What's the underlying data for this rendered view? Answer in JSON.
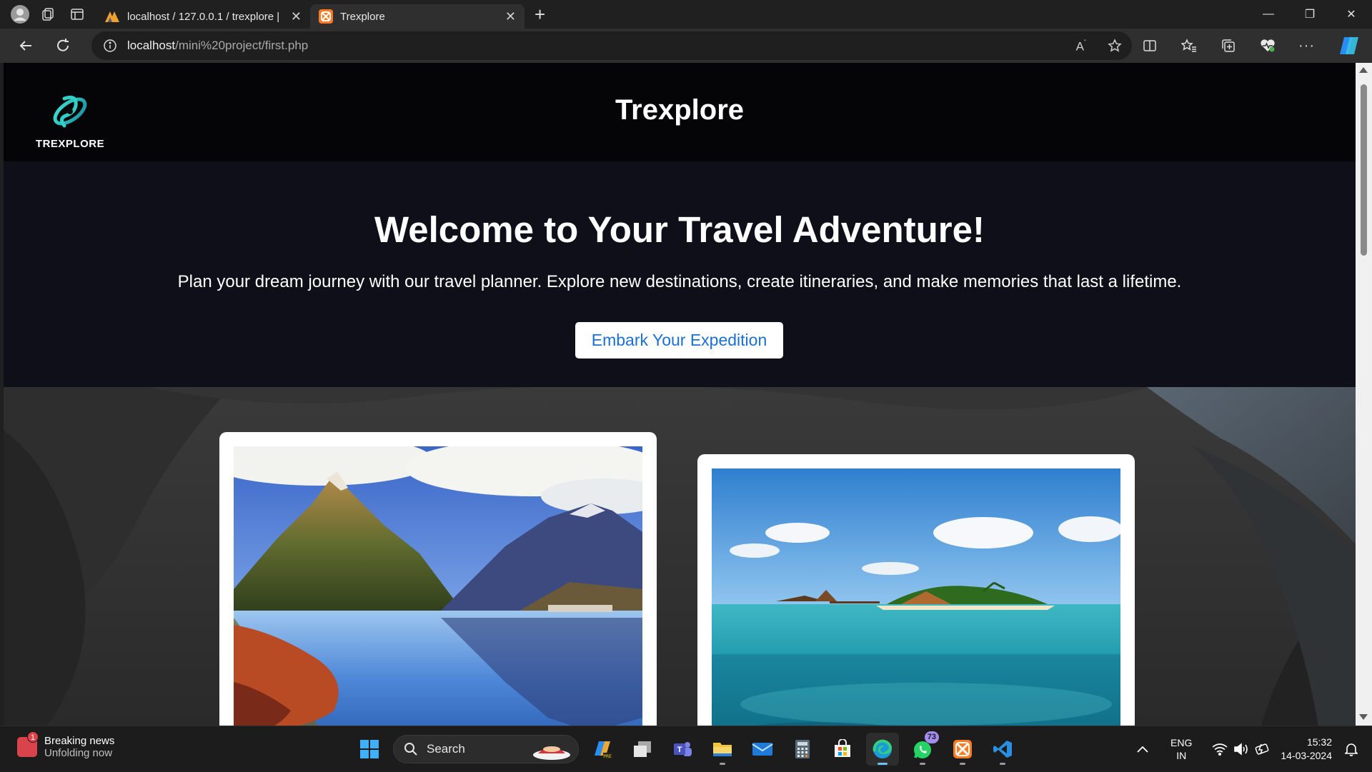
{
  "browser": {
    "tabs": [
      {
        "title": "localhost / 127.0.0.1 / trexplore |",
        "icon": "phpmyadmin-icon"
      },
      {
        "title": "Trexplore",
        "icon": "xampp-icon"
      }
    ],
    "url_host": "localhost",
    "url_path": "/mini%20project/first.php"
  },
  "site": {
    "logo_text": "TREXPLORE",
    "title": "Trexplore",
    "hero_heading": "Welcome to Your Travel Adventure!",
    "hero_text": "Plan your dream journey with our travel planner. Explore new destinations, create itineraries, and make memories that last a lifetime.",
    "cta_label": "Embark Your Expedition",
    "gallery": [
      {
        "scene": "mountain-lake"
      },
      {
        "scene": "tropical-island"
      }
    ]
  },
  "taskbar": {
    "news_title": "Breaking news",
    "news_sub": "Unfolding now",
    "news_badge": "1",
    "search_label": "Search",
    "whatsapp_badge": "73",
    "lang_1": "ENG",
    "lang_2": "IN",
    "time": "15:32",
    "date": "14-03-2024"
  }
}
